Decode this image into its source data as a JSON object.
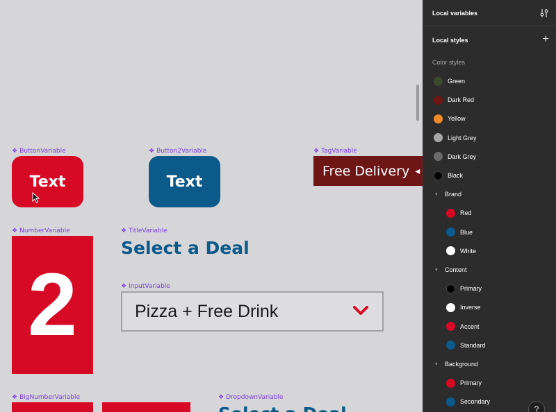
{
  "canvas": {
    "components": [
      {
        "label": "ButtonVariable"
      },
      {
        "label": "Button2Variable"
      },
      {
        "label": "TagVariable"
      },
      {
        "label": "NumberVariable"
      },
      {
        "label": "TitleVariable"
      },
      {
        "label": "InputVariable"
      },
      {
        "label": "BigNumberVariable"
      },
      {
        "label": "DropdownVariable"
      }
    ],
    "button1_text": "Text",
    "button2_text": "Text",
    "tag_text": "Free Delivery",
    "number_text": "2",
    "title_text": "Select a Deal",
    "dropdown_value": "Pizza + Free Drink",
    "dropdown_title_partial": "Select a Deal",
    "component_icon": "component-diamond-icon"
  },
  "panel": {
    "local_variables": "Local variables",
    "local_styles": "Local styles",
    "color_styles": "Color styles",
    "styles": [
      {
        "name": "Green",
        "color": "#3b4a2e"
      },
      {
        "name": "Dark Red",
        "color": "#6e1616"
      },
      {
        "name": "Yellow",
        "color": "#f08a24"
      },
      {
        "name": "Light Grey",
        "color": "#a6a6a6"
      },
      {
        "name": "Dark Grey",
        "color": "#6a6a6a"
      },
      {
        "name": "Black",
        "color": "#000000"
      }
    ],
    "groups": [
      {
        "name": "Brand",
        "items": [
          {
            "name": "Red",
            "color": "#d70a25"
          },
          {
            "name": "Blue",
            "color": "#0b5a8a"
          },
          {
            "name": "White",
            "color": "#ffffff"
          }
        ]
      },
      {
        "name": "Content",
        "items": [
          {
            "name": "Primary",
            "color": "#000000"
          },
          {
            "name": "Inverse",
            "color": "#ffffff"
          },
          {
            "name": "Accent",
            "color": "#d70a25"
          },
          {
            "name": "Standard",
            "color": "#0b5a8a"
          }
        ]
      },
      {
        "name": "Background",
        "items": [
          {
            "name": "Primary",
            "color": "#d70a25"
          },
          {
            "name": "Secondary",
            "color": "#0b5a8a"
          }
        ]
      }
    ],
    "help_label": "?"
  }
}
